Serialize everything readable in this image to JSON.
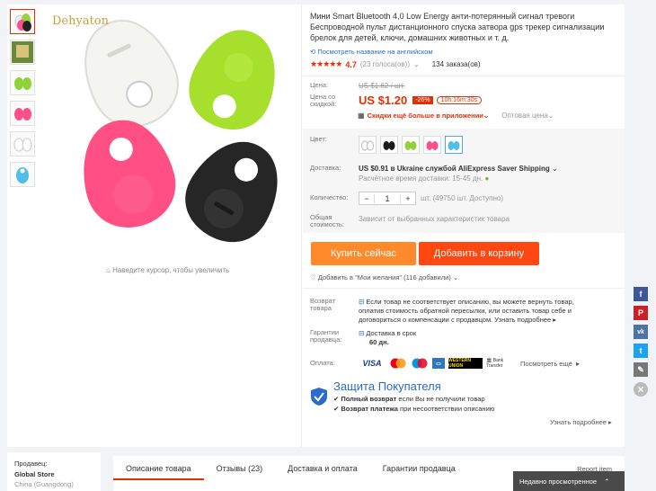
{
  "brand_watermark": "Dehyaton",
  "zoom_hint": "Наведите курсор, чтобы увеличить",
  "product": {
    "title": "Мини Smart Bluetooth 4,0 Low Energy анти-потерянный сигнал тревоги Беспроводной пульт дистанционного спуска затвора gps трекер сигнализации брелок для детей, ключи, домашних животных и т. д.",
    "translate_link": "Посмотреть название на английском",
    "stars": "★★★★★",
    "rating": "4.7",
    "votes": "(23 голоса(ов))",
    "orders": "134 заказа(ов)"
  },
  "price": {
    "price_label": "Цена:",
    "old_price": "US $1.62 / шт.",
    "sale_label": "Цена со скидкой:",
    "sale_price": "US $1.20",
    "discount": "-26%",
    "timer": "10h:16m:30s",
    "app_discount": "Скидки ещё больше в приложении",
    "wholesale": "Оптовая цена"
  },
  "options": {
    "color_label": "Цвет:",
    "colors": [
      "#ffffff",
      "#1a1a1a",
      "#8fd23a",
      "#ff4f8b",
      "#4fbfe8"
    ],
    "shipping_label": "Доставка:",
    "shipping_value": "US $0.91 в Ukraine службой AliExpress Saver Shipping",
    "shipping_time": "Расчётное время доставки: 15-45 дн.",
    "qty_label": "Количество:",
    "qty_value": "1",
    "qty_stock": "шт. (49750 шт. Доступно)",
    "total_label": "Общая стоимость:",
    "total_value": "Зависит от выбранных характеристик товара"
  },
  "buttons": {
    "buy_now": "Купить сейчас",
    "add_cart": "Добавить в корзину",
    "wishlist": "Добавить в \"Мои желания\" (116 добавили)"
  },
  "guarantees": {
    "return_label": "Возврат товара",
    "return_text": "Если товар не соответствует описанию, вы можете вернуть товар, оплатив стоимость обратной пересылки, или оставить товар себе и договориться о компенсации с продавцом.",
    "return_link": "Узнать подробнее",
    "seller_label": "Гарантии продавца:",
    "seller_text": "Доставка в срок",
    "seller_days": "60 дн.",
    "payment_label": "Оплата:",
    "payment_methods": [
      "VISA",
      "MC",
      "MC",
      "AMEX",
      "WU",
      "Bank Transfer"
    ],
    "payment_more": "Посмотреть ещё"
  },
  "buyer_protection": {
    "title": "Защита Покупателя",
    "line1_bold": "Полный возврат",
    "line1": "если Вы не получили товар",
    "line2_bold": "Возврат платежа",
    "line2": "при несоответствии описанию",
    "more": "Узнать подробнее"
  },
  "social": [
    "f",
    "P",
    "vk",
    "t",
    "✎",
    "×"
  ],
  "seller": {
    "label": "Продавец:",
    "name": "Global Store",
    "location": "China (Guangdong)"
  },
  "tabs": [
    "Описание товара",
    "Отзывы (23)",
    "Доставка и оплата",
    "Гарантии продавца"
  ],
  "report": "Report item",
  "recently_viewed": "Недавно просмотренное"
}
